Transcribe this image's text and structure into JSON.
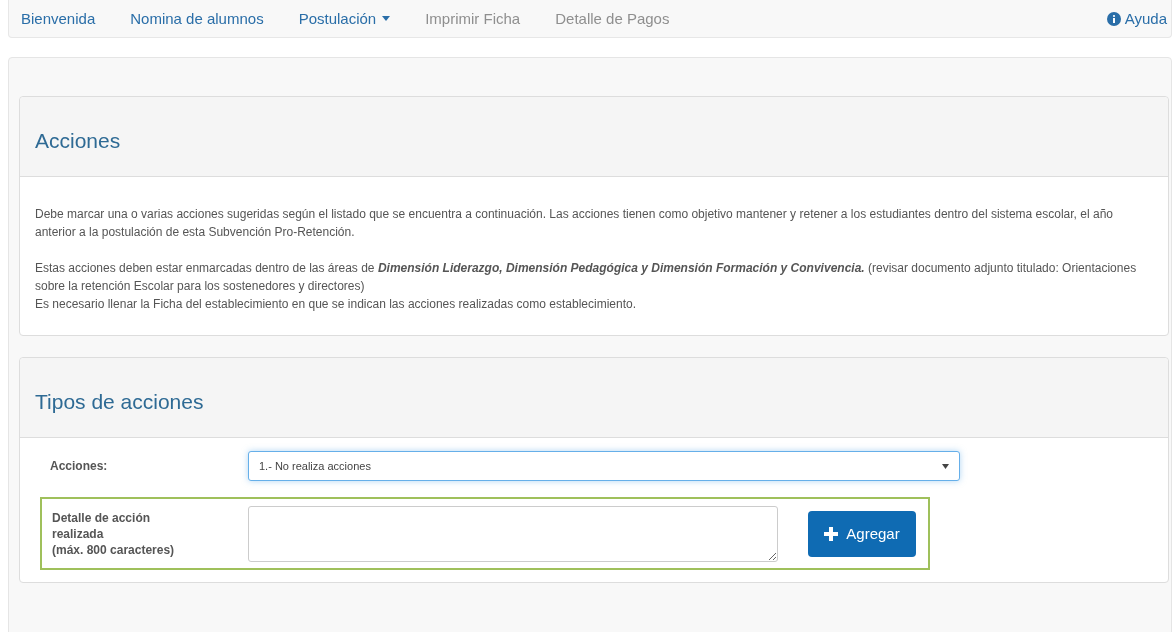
{
  "nav": {
    "items": [
      {
        "label": "Bienvenida",
        "disabled": false,
        "dropdown": false
      },
      {
        "label": "Nomina de alumnos",
        "disabled": false,
        "dropdown": false
      },
      {
        "label": "Postulación",
        "disabled": false,
        "dropdown": true
      },
      {
        "label": "Imprimir Ficha",
        "disabled": true,
        "dropdown": false
      },
      {
        "label": "Detalle de Pagos",
        "disabled": true,
        "dropdown": false
      }
    ],
    "help": "Ayuda"
  },
  "acciones_panel": {
    "title": "Acciones",
    "paragraphs": [
      "Debe marcar una o varias acciones sugeridas según el listado que se encuentra a continuación. Las acciones tienen como objetivo mantener y retener a los estudiantes dentro del sistema escolar, el año anterior a la postulación de esta Subvención Pro-Retención.",
      "Estas acciones deben estar enmarcadas dentro de las áreas de **Dimensión Liderazgo, Dimensión Pedagógica y Dimensión Formación y Convivencia.** (revisar documento adjunto titulado: Orientaciones sobre la retención Escolar para los sostenedores y directores)",
      "Es necesario llenar la Ficha del establecimiento en que se indican las acciones realizadas como establecimiento."
    ]
  },
  "tipos_panel": {
    "title": "Tipos de acciones",
    "acciones_label": "Acciones:",
    "acciones_value": "1.- No realiza acciones",
    "detalle_label": [
      "Detalle de acción",
      "realizada",
      "(máx. 800 caracteres)"
    ],
    "add_button": "Agregar"
  }
}
